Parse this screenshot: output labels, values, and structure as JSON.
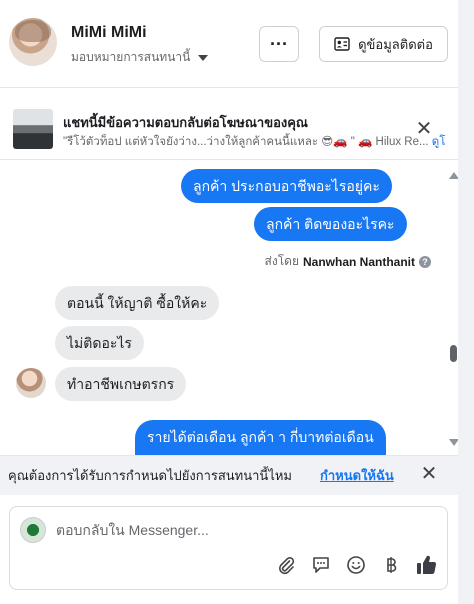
{
  "header": {
    "name": "MiMi MiMi",
    "assign_label": "มอบหมายการสนทนานี้",
    "more_label": "···",
    "contact_label": "ดูข้อมูลติดต่อ"
  },
  "ad_banner": {
    "title": "แชทนี้มีข้อความตอบกลับต่อโฆษณาของคุณ",
    "subtitle": "\"รีโว้ตัวท็อป แต่หัวใจยังว่าง...ว่างให้ลูกค้าคนนี้แหละ 😎🚗 \" 🚗 Hilux Re...",
    "link": "ดูโ",
    "close": "✕"
  },
  "messages": [
    {
      "direction": "out",
      "text": "ลูกค้า   ประกอบอาชีพอะไรอยู่คะ"
    },
    {
      "direction": "out",
      "text": "ลูกค้า ติดของอะไรคะ"
    },
    {
      "direction": "in",
      "text": "ตอนนี้ ให้ญาติ ซื้อให้คะ"
    },
    {
      "direction": "in",
      "text": "ไม่ติดอะไร"
    },
    {
      "direction": "in",
      "text": "ทำอาชีพเกษตรกร"
    },
    {
      "direction": "out",
      "text": "รายได้ต่อเดือน ลูกค้า า  กี่บาทต่อเดือน"
    }
  ],
  "sent_by": {
    "prefix": "ส่งโดย",
    "name": "Nanwhan Nanthanit",
    "help": "?"
  },
  "assign_prompt": {
    "text": "คุณต้องการได้รับการกำหนดไปยังการสนทนานี้ไหม",
    "link": "กำหนดให้ฉัน",
    "close": "✕"
  },
  "composer": {
    "placeholder": "ตอบกลับใน Messenger...",
    "tools": [
      "paperclip-icon",
      "chat-bubble-icon",
      "emoji-icon",
      "baht-icon",
      "thumbs-up-icon"
    ]
  },
  "colors": {
    "accent": "#1877f2",
    "incoming_bubble": "#e9eaec",
    "muted": "#65676b"
  }
}
